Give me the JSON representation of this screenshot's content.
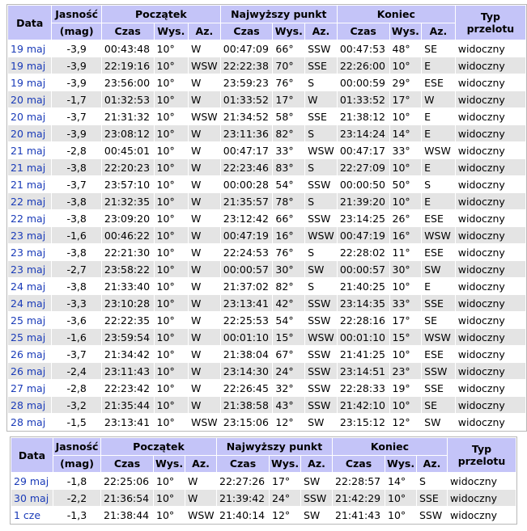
{
  "headers": {
    "date": "Data",
    "brightness": "Jasność",
    "brightness_unit": "(mag)",
    "start": "Początek",
    "highest": "Najwyższy punkt",
    "end": "Koniec",
    "type": "Typ przelotu",
    "time": "Czas",
    "alt": "Wys.",
    "az": "Az."
  },
  "table1": [
    {
      "date": "19 maj",
      "mag": "-3,9",
      "s_time": "00:43:48",
      "s_alt": "10°",
      "s_az": "W",
      "h_time": "00:47:09",
      "h_alt": "66°",
      "h_az": "SSW",
      "e_time": "00:47:53",
      "e_alt": "48°",
      "e_az": "SE",
      "type": "widoczny"
    },
    {
      "date": "19 maj",
      "mag": "-3,9",
      "s_time": "22:19:16",
      "s_alt": "10°",
      "s_az": "WSW",
      "h_time": "22:22:38",
      "h_alt": "70°",
      "h_az": "SSE",
      "e_time": "22:26:00",
      "e_alt": "10°",
      "e_az": "E",
      "type": "widoczny"
    },
    {
      "date": "19 maj",
      "mag": "-3,9",
      "s_time": "23:56:00",
      "s_alt": "10°",
      "s_az": "W",
      "h_time": "23:59:23",
      "h_alt": "76°",
      "h_az": "S",
      "e_time": "00:00:59",
      "e_alt": "29°",
      "e_az": "ESE",
      "type": "widoczny"
    },
    {
      "date": "20 maj",
      "mag": "-1,7",
      "s_time": "01:32:53",
      "s_alt": "10°",
      "s_az": "W",
      "h_time": "01:33:52",
      "h_alt": "17°",
      "h_az": "W",
      "e_time": "01:33:52",
      "e_alt": "17°",
      "e_az": "W",
      "type": "widoczny"
    },
    {
      "date": "20 maj",
      "mag": "-3,7",
      "s_time": "21:31:32",
      "s_alt": "10°",
      "s_az": "WSW",
      "h_time": "21:34:52",
      "h_alt": "58°",
      "h_az": "SSE",
      "e_time": "21:38:12",
      "e_alt": "10°",
      "e_az": "E",
      "type": "widoczny"
    },
    {
      "date": "20 maj",
      "mag": "-3,9",
      "s_time": "23:08:12",
      "s_alt": "10°",
      "s_az": "W",
      "h_time": "23:11:36",
      "h_alt": "82°",
      "h_az": "S",
      "e_time": "23:14:24",
      "e_alt": "14°",
      "e_az": "E",
      "type": "widoczny"
    },
    {
      "date": "21 maj",
      "mag": "-2,8",
      "s_time": "00:45:01",
      "s_alt": "10°",
      "s_az": "W",
      "h_time": "00:47:17",
      "h_alt": "33°",
      "h_az": "WSW",
      "e_time": "00:47:17",
      "e_alt": "33°",
      "e_az": "WSW",
      "type": "widoczny"
    },
    {
      "date": "21 maj",
      "mag": "-3,8",
      "s_time": "22:20:23",
      "s_alt": "10°",
      "s_az": "W",
      "h_time": "22:23:46",
      "h_alt": "83°",
      "h_az": "S",
      "e_time": "22:27:09",
      "e_alt": "10°",
      "e_az": "E",
      "type": "widoczny"
    },
    {
      "date": "21 maj",
      "mag": "-3,7",
      "s_time": "23:57:10",
      "s_alt": "10°",
      "s_az": "W",
      "h_time": "00:00:28",
      "h_alt": "54°",
      "h_az": "SSW",
      "e_time": "00:00:50",
      "e_alt": "50°",
      "e_az": "S",
      "type": "widoczny"
    },
    {
      "date": "22 maj",
      "mag": "-3,8",
      "s_time": "21:32:35",
      "s_alt": "10°",
      "s_az": "W",
      "h_time": "21:35:57",
      "h_alt": "78°",
      "h_az": "S",
      "e_time": "21:39:20",
      "e_alt": "10°",
      "e_az": "E",
      "type": "widoczny"
    },
    {
      "date": "22 maj",
      "mag": "-3,8",
      "s_time": "23:09:20",
      "s_alt": "10°",
      "s_az": "W",
      "h_time": "23:12:42",
      "h_alt": "66°",
      "h_az": "SSW",
      "e_time": "23:14:25",
      "e_alt": "26°",
      "e_az": "ESE",
      "type": "widoczny"
    },
    {
      "date": "23 maj",
      "mag": "-1,6",
      "s_time": "00:46:22",
      "s_alt": "10°",
      "s_az": "W",
      "h_time": "00:47:19",
      "h_alt": "16°",
      "h_az": "WSW",
      "e_time": "00:47:19",
      "e_alt": "16°",
      "e_az": "WSW",
      "type": "widoczny"
    },
    {
      "date": "23 maj",
      "mag": "-3,8",
      "s_time": "22:21:30",
      "s_alt": "10°",
      "s_az": "W",
      "h_time": "22:24:53",
      "h_alt": "76°",
      "h_az": "S",
      "e_time": "22:28:02",
      "e_alt": "11°",
      "e_az": "ESE",
      "type": "widoczny"
    },
    {
      "date": "23 maj",
      "mag": "-2,7",
      "s_time": "23:58:22",
      "s_alt": "10°",
      "s_az": "W",
      "h_time": "00:00:57",
      "h_alt": "30°",
      "h_az": "SW",
      "e_time": "00:00:57",
      "e_alt": "30°",
      "e_az": "SW",
      "type": "widoczny"
    },
    {
      "date": "24 maj",
      "mag": "-3,8",
      "s_time": "21:33:40",
      "s_alt": "10°",
      "s_az": "W",
      "h_time": "21:37:02",
      "h_alt": "82°",
      "h_az": "S",
      "e_time": "21:40:25",
      "e_alt": "10°",
      "e_az": "E",
      "type": "widoczny"
    },
    {
      "date": "24 maj",
      "mag": "-3,3",
      "s_time": "23:10:28",
      "s_alt": "10°",
      "s_az": "W",
      "h_time": "23:13:41",
      "h_alt": "42°",
      "h_az": "SSW",
      "e_time": "23:14:35",
      "e_alt": "33°",
      "e_az": "SSE",
      "type": "widoczny"
    },
    {
      "date": "25 maj",
      "mag": "-3,6",
      "s_time": "22:22:35",
      "s_alt": "10°",
      "s_az": "W",
      "h_time": "22:25:53",
      "h_alt": "54°",
      "h_az": "SSW",
      "e_time": "22:28:16",
      "e_alt": "17°",
      "e_az": "SE",
      "type": "widoczny"
    },
    {
      "date": "25 maj",
      "mag": "-1,6",
      "s_time": "23:59:54",
      "s_alt": "10°",
      "s_az": "W",
      "h_time": "00:01:10",
      "h_alt": "15°",
      "h_az": "WSW",
      "e_time": "00:01:10",
      "e_alt": "15°",
      "e_az": "WSW",
      "type": "widoczny"
    },
    {
      "date": "26 maj",
      "mag": "-3,7",
      "s_time": "21:34:42",
      "s_alt": "10°",
      "s_az": "W",
      "h_time": "21:38:04",
      "h_alt": "67°",
      "h_az": "SSW",
      "e_time": "21:41:25",
      "e_alt": "10°",
      "e_az": "ESE",
      "type": "widoczny"
    },
    {
      "date": "26 maj",
      "mag": "-2,4",
      "s_time": "23:11:43",
      "s_alt": "10°",
      "s_az": "W",
      "h_time": "23:14:30",
      "h_alt": "24°",
      "h_az": "SSW",
      "e_time": "23:14:51",
      "e_alt": "23°",
      "e_az": "SSW",
      "type": "widoczny"
    },
    {
      "date": "27 maj",
      "mag": "-2,8",
      "s_time": "22:23:42",
      "s_alt": "10°",
      "s_az": "W",
      "h_time": "22:26:45",
      "h_alt": "32°",
      "h_az": "SSW",
      "e_time": "22:28:33",
      "e_alt": "19°",
      "e_az": "SSE",
      "type": "widoczny"
    },
    {
      "date": "28 maj",
      "mag": "-3,2",
      "s_time": "21:35:44",
      "s_alt": "10°",
      "s_az": "W",
      "h_time": "21:38:58",
      "h_alt": "43°",
      "h_az": "SSW",
      "e_time": "21:42:10",
      "e_alt": "10°",
      "e_az": "SE",
      "type": "widoczny"
    },
    {
      "date": "28 maj",
      "mag": "-1,5",
      "s_time": "23:13:41",
      "s_alt": "10°",
      "s_az": "WSW",
      "h_time": "23:15:06",
      "h_alt": "12°",
      "h_az": "SW",
      "e_time": "23:15:12",
      "e_alt": "12°",
      "e_az": "SW",
      "type": "widoczny"
    }
  ],
  "table2": [
    {
      "date": "29 maj",
      "mag": "-1,8",
      "s_time": "22:25:06",
      "s_alt": "10°",
      "s_az": "W",
      "h_time": "22:27:26",
      "h_alt": "17°",
      "h_az": "SW",
      "e_time": "22:28:57",
      "e_alt": "14°",
      "e_az": "S",
      "type": "widoczny"
    },
    {
      "date": "30 maj",
      "mag": "-2,2",
      "s_time": "21:36:54",
      "s_alt": "10°",
      "s_az": "W",
      "h_time": "21:39:42",
      "h_alt": "24°",
      "h_az": "SSW",
      "e_time": "21:42:29",
      "e_alt": "10°",
      "e_az": "SSE",
      "type": "widoczny"
    },
    {
      "date": "1 cze",
      "mag": "-1,3",
      "s_time": "21:38:44",
      "s_alt": "10°",
      "s_az": "WSW",
      "h_time": "21:40:14",
      "h_alt": "12°",
      "h_az": "SW",
      "e_time": "21:41:43",
      "e_alt": "10°",
      "e_az": "SSW",
      "type": "widoczny"
    }
  ]
}
